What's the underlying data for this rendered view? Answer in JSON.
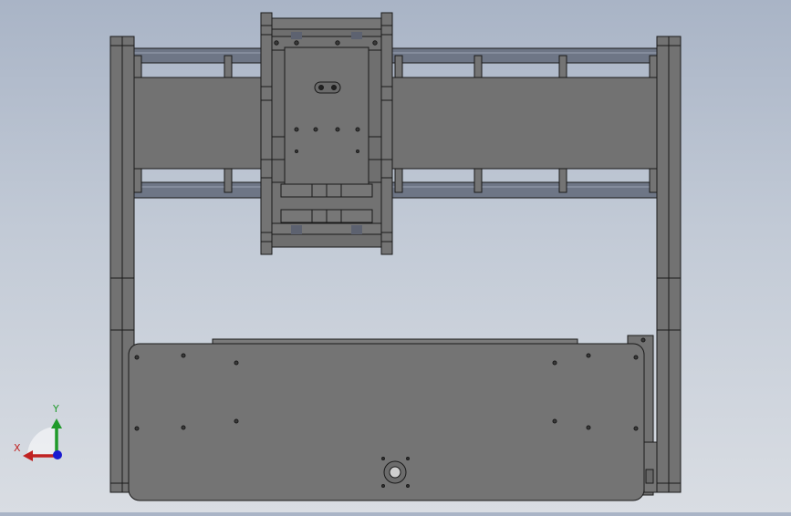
{
  "viewport": {
    "background_top": "#a9b4c6",
    "background_bottom": "#d9dde3",
    "part_fill": "#717171",
    "part_fill_light": "#7b7b7b",
    "edge_color": "#1a1a1a",
    "rod_color": "#6e7686"
  },
  "triad": {
    "x_label": "X",
    "y_label": "Y",
    "x_color": "#c02222",
    "y_color": "#1f9a2a",
    "z_color": "#1a1ad0"
  }
}
